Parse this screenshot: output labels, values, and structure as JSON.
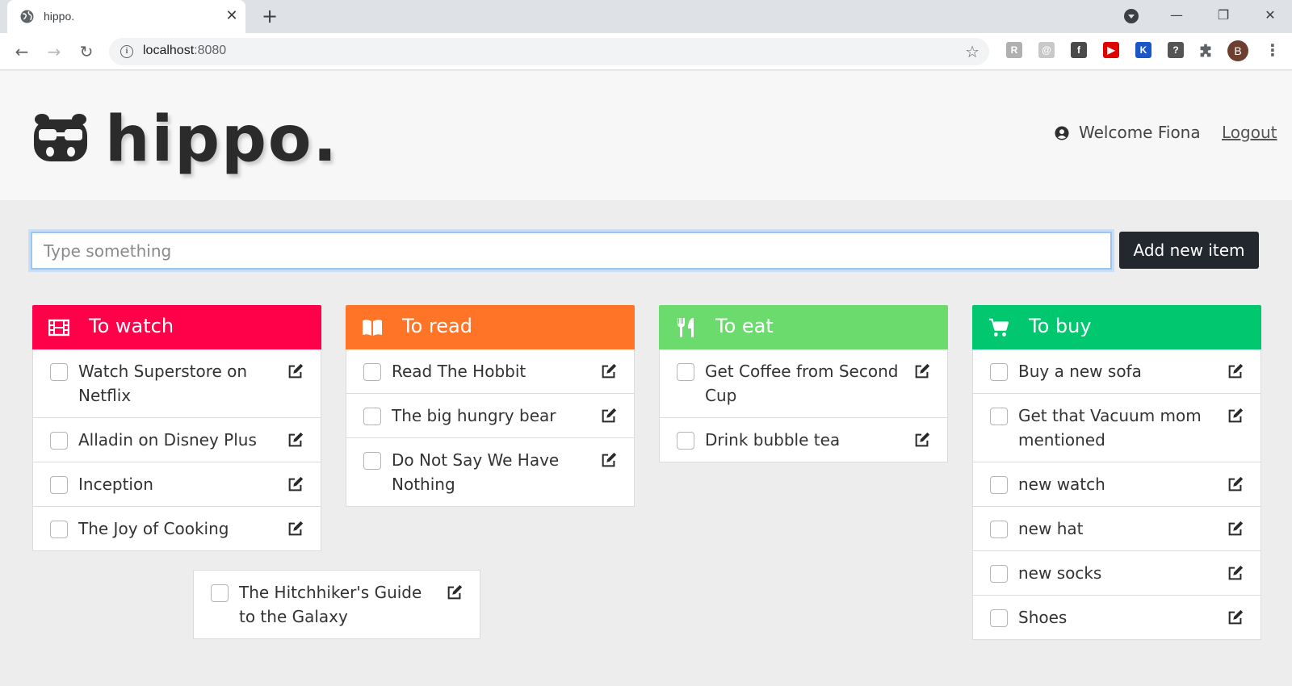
{
  "browser": {
    "tab_title": "hippo.",
    "url_host": "localhost",
    "url_port": ":8080",
    "avatar_initial": "B",
    "extensions": [
      {
        "name": "extension-1-icon",
        "color": "#b0b0b0",
        "glyph": "R"
      },
      {
        "name": "extension-2-icon",
        "color": "#c8c8c8",
        "glyph": "@"
      },
      {
        "name": "facebook-extension-icon",
        "color": "#4a4a4a",
        "glyph": "f"
      },
      {
        "name": "youtube-extension-icon",
        "color": "#e00000",
        "glyph": "▶"
      },
      {
        "name": "k-extension-icon",
        "color": "#1a56c8",
        "glyph": "K"
      },
      {
        "name": "help-extension-icon",
        "color": "#555555",
        "glyph": "?"
      }
    ]
  },
  "header": {
    "logo_text": "hippo.",
    "welcome": "Welcome Fiona",
    "logout": "Logout"
  },
  "add_form": {
    "placeholder": "Type something",
    "button_label": "Add new item"
  },
  "columns": [
    {
      "title": "To watch",
      "color": "#ff0149",
      "icon": "film-icon",
      "items": [
        "Watch Superstore on Netflix",
        "Alladin on Disney Plus",
        "Inception",
        "The Joy of Cooking"
      ]
    },
    {
      "title": "To read",
      "color": "#ff7426",
      "icon": "book-icon",
      "items": [
        "Read The Hobbit",
        "The big hungry bear",
        "Do Not Say We Have Nothing"
      ]
    },
    {
      "title": "To eat",
      "color": "#6cdb6e",
      "icon": "utensils-icon",
      "items": [
        "Get Coffee from Second Cup",
        "Drink bubble tea"
      ]
    },
    {
      "title": "To buy",
      "color": "#01c86f",
      "icon": "cart-icon",
      "items": [
        "Buy a new sofa",
        "Get that Vacuum mom mentioned",
        "new watch",
        "new hat",
        "new socks",
        "Shoes"
      ]
    }
  ],
  "dragging_item": "The Hitchhiker's Guide to the Galaxy"
}
